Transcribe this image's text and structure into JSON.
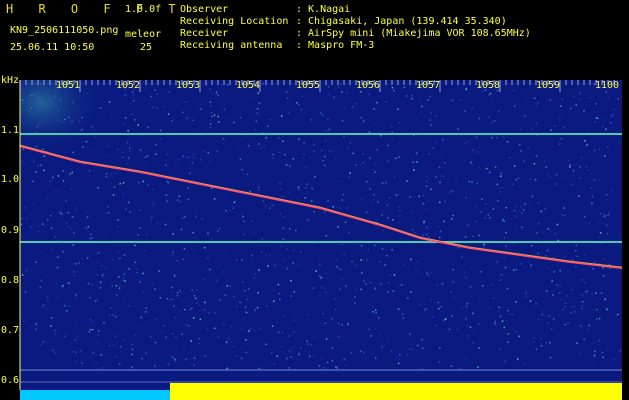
{
  "header": {
    "program_title": "H R O F F T",
    "version": "1.0.0f",
    "file_name": "KN9_2506111050.png",
    "datetime": "25.06.11 10:50",
    "station_label": "meleor",
    "station_value": "25",
    "info": [
      {
        "label": "Observer",
        "value": ": K.Nagai"
      },
      {
        "label": "Receiving Location",
        "value": ": Chigasaki, Japan (139.414 35.340)"
      },
      {
        "label": "Receiver",
        "value": ": AirSpy mini (Miakejima VOR 108.65MHz)"
      },
      {
        "label": "Receiving antenna",
        "value": ": Maspro FM-3"
      }
    ]
  },
  "axes": {
    "y_unit": "kHz",
    "y_ticks": [
      "1.1",
      "1.0",
      "0.9",
      "0.8",
      "0.7",
      "0.6"
    ],
    "x_ticks": [
      "1051",
      "1052",
      "1053",
      "1054",
      "1055",
      "1056",
      "1057",
      "1058",
      "1059",
      "1100"
    ]
  },
  "colors": {
    "background": "#000000",
    "waterfall": "#00105a",
    "text": "#ffff40",
    "trace": "#e04060",
    "band_line": "#60ffb0",
    "bottom_bar_left": "#00c8ff",
    "bottom_bar_right": "#ffff00"
  }
}
